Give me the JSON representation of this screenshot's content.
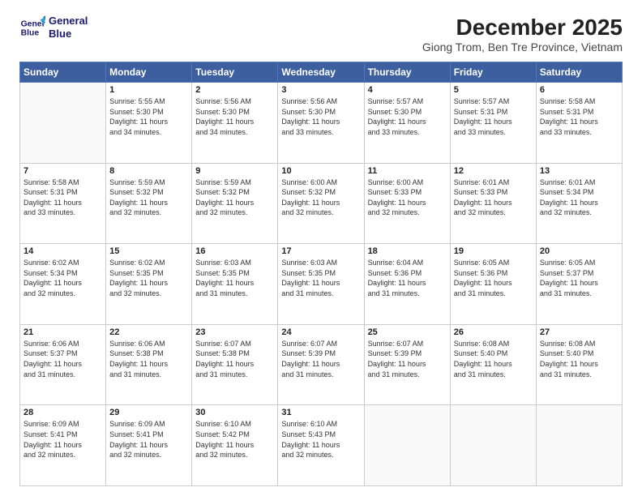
{
  "logo": {
    "line1": "General",
    "line2": "Blue"
  },
  "title": "December 2025",
  "subtitle": "Giong Trom, Ben Tre Province, Vietnam",
  "days_header": [
    "Sunday",
    "Monday",
    "Tuesday",
    "Wednesday",
    "Thursday",
    "Friday",
    "Saturday"
  ],
  "weeks": [
    [
      {
        "day": "",
        "info": ""
      },
      {
        "day": "1",
        "info": "Sunrise: 5:55 AM\nSunset: 5:30 PM\nDaylight: 11 hours\nand 34 minutes."
      },
      {
        "day": "2",
        "info": "Sunrise: 5:56 AM\nSunset: 5:30 PM\nDaylight: 11 hours\nand 34 minutes."
      },
      {
        "day": "3",
        "info": "Sunrise: 5:56 AM\nSunset: 5:30 PM\nDaylight: 11 hours\nand 33 minutes."
      },
      {
        "day": "4",
        "info": "Sunrise: 5:57 AM\nSunset: 5:30 PM\nDaylight: 11 hours\nand 33 minutes."
      },
      {
        "day": "5",
        "info": "Sunrise: 5:57 AM\nSunset: 5:31 PM\nDaylight: 11 hours\nand 33 minutes."
      },
      {
        "day": "6",
        "info": "Sunrise: 5:58 AM\nSunset: 5:31 PM\nDaylight: 11 hours\nand 33 minutes."
      }
    ],
    [
      {
        "day": "7",
        "info": "Sunrise: 5:58 AM\nSunset: 5:31 PM\nDaylight: 11 hours\nand 33 minutes."
      },
      {
        "day": "8",
        "info": "Sunrise: 5:59 AM\nSunset: 5:32 PM\nDaylight: 11 hours\nand 32 minutes."
      },
      {
        "day": "9",
        "info": "Sunrise: 5:59 AM\nSunset: 5:32 PM\nDaylight: 11 hours\nand 32 minutes."
      },
      {
        "day": "10",
        "info": "Sunrise: 6:00 AM\nSunset: 5:32 PM\nDaylight: 11 hours\nand 32 minutes."
      },
      {
        "day": "11",
        "info": "Sunrise: 6:00 AM\nSunset: 5:33 PM\nDaylight: 11 hours\nand 32 minutes."
      },
      {
        "day": "12",
        "info": "Sunrise: 6:01 AM\nSunset: 5:33 PM\nDaylight: 11 hours\nand 32 minutes."
      },
      {
        "day": "13",
        "info": "Sunrise: 6:01 AM\nSunset: 5:34 PM\nDaylight: 11 hours\nand 32 minutes."
      }
    ],
    [
      {
        "day": "14",
        "info": "Sunrise: 6:02 AM\nSunset: 5:34 PM\nDaylight: 11 hours\nand 32 minutes."
      },
      {
        "day": "15",
        "info": "Sunrise: 6:02 AM\nSunset: 5:35 PM\nDaylight: 11 hours\nand 32 minutes."
      },
      {
        "day": "16",
        "info": "Sunrise: 6:03 AM\nSunset: 5:35 PM\nDaylight: 11 hours\nand 31 minutes."
      },
      {
        "day": "17",
        "info": "Sunrise: 6:03 AM\nSunset: 5:35 PM\nDaylight: 11 hours\nand 31 minutes."
      },
      {
        "day": "18",
        "info": "Sunrise: 6:04 AM\nSunset: 5:36 PM\nDaylight: 11 hours\nand 31 minutes."
      },
      {
        "day": "19",
        "info": "Sunrise: 6:05 AM\nSunset: 5:36 PM\nDaylight: 11 hours\nand 31 minutes."
      },
      {
        "day": "20",
        "info": "Sunrise: 6:05 AM\nSunset: 5:37 PM\nDaylight: 11 hours\nand 31 minutes."
      }
    ],
    [
      {
        "day": "21",
        "info": "Sunrise: 6:06 AM\nSunset: 5:37 PM\nDaylight: 11 hours\nand 31 minutes."
      },
      {
        "day": "22",
        "info": "Sunrise: 6:06 AM\nSunset: 5:38 PM\nDaylight: 11 hours\nand 31 minutes."
      },
      {
        "day": "23",
        "info": "Sunrise: 6:07 AM\nSunset: 5:38 PM\nDaylight: 11 hours\nand 31 minutes."
      },
      {
        "day": "24",
        "info": "Sunrise: 6:07 AM\nSunset: 5:39 PM\nDaylight: 11 hours\nand 31 minutes."
      },
      {
        "day": "25",
        "info": "Sunrise: 6:07 AM\nSunset: 5:39 PM\nDaylight: 11 hours\nand 31 minutes."
      },
      {
        "day": "26",
        "info": "Sunrise: 6:08 AM\nSunset: 5:40 PM\nDaylight: 11 hours\nand 31 minutes."
      },
      {
        "day": "27",
        "info": "Sunrise: 6:08 AM\nSunset: 5:40 PM\nDaylight: 11 hours\nand 31 minutes."
      }
    ],
    [
      {
        "day": "28",
        "info": "Sunrise: 6:09 AM\nSunset: 5:41 PM\nDaylight: 11 hours\nand 32 minutes."
      },
      {
        "day": "29",
        "info": "Sunrise: 6:09 AM\nSunset: 5:41 PM\nDaylight: 11 hours\nand 32 minutes."
      },
      {
        "day": "30",
        "info": "Sunrise: 6:10 AM\nSunset: 5:42 PM\nDaylight: 11 hours\nand 32 minutes."
      },
      {
        "day": "31",
        "info": "Sunrise: 6:10 AM\nSunset: 5:43 PM\nDaylight: 11 hours\nand 32 minutes."
      },
      {
        "day": "",
        "info": ""
      },
      {
        "day": "",
        "info": ""
      },
      {
        "day": "",
        "info": ""
      }
    ]
  ]
}
